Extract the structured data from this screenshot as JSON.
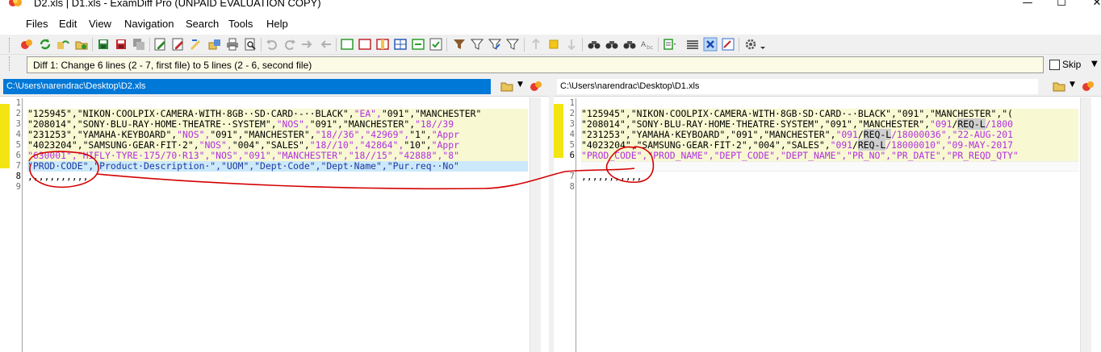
{
  "window": {
    "title": "D2.xls  |  D1.xls - ExamDiff Pro (UNPAID EVALUATION COPY)",
    "min_glyph": "—",
    "max_glyph": "☐",
    "close_glyph": "✕"
  },
  "menu": [
    "Files",
    "Edit",
    "View",
    "Navigation",
    "Search",
    "Tools",
    "Help"
  ],
  "toolbar_icons": [
    "open-files-icon",
    "refresh-icon",
    "rescan-icon",
    "open-folder-icon",
    "save-icon",
    "save-as-icon",
    "save-all-icon",
    "edit-left-icon",
    "edit-right-icon",
    "merge-left-icon",
    "copy-icon",
    "print-icon",
    "print-preview-icon",
    "undo-icon",
    "redo-icon",
    "next-arrow-icon",
    "prev-arrow-icon",
    "view-left-icon",
    "view-right-icon",
    "view-both-icon",
    "view-grid-icon",
    "sync-icon",
    "check-icon",
    "filter-icon",
    "filter-off-icon",
    "filter-edit-icon",
    "filter-clear-icon",
    "prev-diff-icon",
    "current-diff-icon",
    "next-diff-icon",
    "find-icon",
    "find-next-icon",
    "find-prev-icon",
    "replace-icon",
    "options-icon",
    "align-icon",
    "word-wrap-icon",
    "report-icon",
    "settings-icon"
  ],
  "diff_info": {
    "text": "Diff 1: Change 6 lines (2 - 7, first file) to 5 lines (2 - 6, second file)",
    "skip_label": "Skip"
  },
  "left_pane": {
    "path": "C:\\Users\\narendrac\\Desktop\\D2.xls",
    "line_numbers": [
      "1",
      "2",
      "3",
      "4",
      "5",
      "6",
      "7",
      "8",
      "9"
    ],
    "lines": {
      "l2": {
        "a": "\"125945\",\"NIKON·COOLPIX·CAMERA·WITH·8GB··SD·CARD·-··BLACK\",",
        "b": "\"EA\",",
        "c": "\"091\",\"MANCHESTER\""
      },
      "l3": {
        "a": "\"208014\",\"SONY·BLU-RAY·HOME·THEATRE··SYSTEM\",",
        "b": "\"NOS\",",
        "c": "\"091\",\"MANCHESTER\",",
        "d": "\"18//39"
      },
      "l4": {
        "a": "\"231253\",\"YAMAHA·KEYBOARD\",",
        "b": "\"NOS\",",
        "c": "\"091\",\"MANCHESTER\",",
        "d": "\"18//36\",",
        "e": "\"42969\",",
        "f": "\"1\",",
        "g": "\"Appr"
      },
      "l5": {
        "a": "\"4023204\",\"SAMSUNG·GEAR·FIT·2\",",
        "b": "\"NOS\",",
        "c": "\"004\",\"SALES\",",
        "d": "\"18//10\",",
        "e": "\"42864\",",
        "f": "\"10\",",
        "g": "\"Appr"
      },
      "l6": {
        "a": "\"630001\",",
        "b": "\"HIFLY·TYRE·175/70·R13\",",
        "c": "\"NOS\",",
        "d": "\"091\",",
        "e": "\"MANCHESTER\",",
        "f": "\"18//15\",",
        "g": "\"42888\",",
        "h": "\"8\""
      },
      "l7": "\"PROD·CODE\",\"Product·Description·\",\"UOM\",\"Dept·Code\",\"Dept·Name\",\"Pur.req··No\"",
      "l8": ",,,,,,,,,,,"
    }
  },
  "right_pane": {
    "path": "C:\\Users\\narendrac\\Desktop\\D1.xls",
    "line_numbers": [
      "1",
      "2",
      "3",
      "4",
      "5",
      "6",
      "7",
      "8"
    ],
    "lines": {
      "l2": "\"125945\",\"NIKON·COOLPIX·CAMERA·WITH·8GB·SD·CARD·-·BLACK\",\"091\",\"MANCHESTER\",\"(",
      "l3": {
        "a": "\"208014\",\"SONY·BLU-RAY·HOME·THEATRE·SYSTEM\",\"091\",\"MANCHESTER\",",
        "b": "\"091",
        "c": "/",
        "d": "REQ-L",
        "e": "/1800"
      },
      "l4": {
        "a": "\"231253\",\"YAMAHA·KEYBOARD\",\"091\",\"MANCHESTER\",",
        "b": "\"091",
        "c": "/",
        "d": "REQ-L",
        "e": "/18000036\",",
        "f": "\"22-AUG-201"
      },
      "l5": {
        "a": "\"4023204\",\"SAMSUNG·GEAR·FIT·2\",\"004\",\"SALES\",",
        "b": "\"091",
        "c": "/",
        "d": "REQ-L",
        "e": "/18000010\",",
        "f": "\"09-MAY-2017"
      },
      "l6": "\"PROD_CODE\",\"PROD_NAME\",\"DEPT_CODE\",\"DEPT_NAME\",\"PR_NO\",\"PR_DATE\",\"PR_REQD_QTY\"",
      "l7": ",,,,,,,,,,,"
    }
  },
  "colors": {
    "accent": "#0078d7",
    "diff_marker": "#f3e512",
    "changed_word": "#b030e0",
    "annotation": "#d40000"
  }
}
